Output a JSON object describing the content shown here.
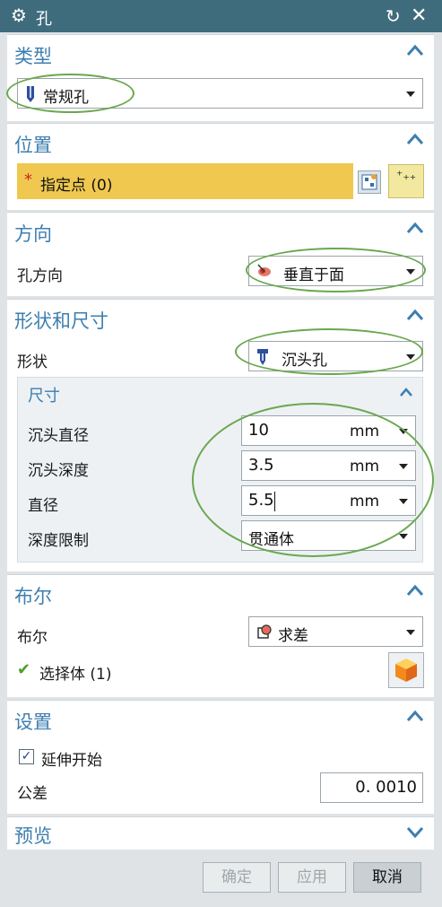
{
  "window": {
    "title": "孔",
    "icon": "gear-icon"
  },
  "type_section": {
    "header": "类型",
    "type_value": "常规孔"
  },
  "position_section": {
    "header": "位置",
    "specify_point": "指定点 (0)",
    "required_marker": "*"
  },
  "direction_section": {
    "header": "方向",
    "hole_direction_label": "孔方向",
    "hole_direction_value": "垂直于面"
  },
  "shape_section": {
    "header": "形状和尺寸",
    "shape_label": "形状",
    "shape_value": "沉头孔",
    "dimensions": {
      "header": "尺寸",
      "counterbore_diameter_label": "沉头直径",
      "counterbore_diameter_value": "10",
      "counterbore_depth_label": "沉头深度",
      "counterbore_depth_value": "3.5",
      "diameter_label": "直径",
      "diameter_value": "5.5",
      "unit": "mm",
      "depth_limit_label": "深度限制",
      "depth_limit_value": "贯通体"
    }
  },
  "boolean_section": {
    "header": "布尔",
    "boolean_label": "布尔",
    "boolean_value": "求差",
    "select_body": "选择体 (1)"
  },
  "settings_section": {
    "header": "设置",
    "extend_start_label": "延伸开始",
    "extend_start_checked": true,
    "tolerance_label": "公差",
    "tolerance_value": "0. 0010"
  },
  "preview_section": {
    "header": "预览"
  },
  "footer": {
    "ok": "确定",
    "apply": "应用",
    "cancel": "取消"
  },
  "colors": {
    "title_bar": "#3f6c7d",
    "section_header": "#3d7fb0",
    "required_field": "#f0c84f",
    "annotation_ellipse": "#6aa84f"
  }
}
